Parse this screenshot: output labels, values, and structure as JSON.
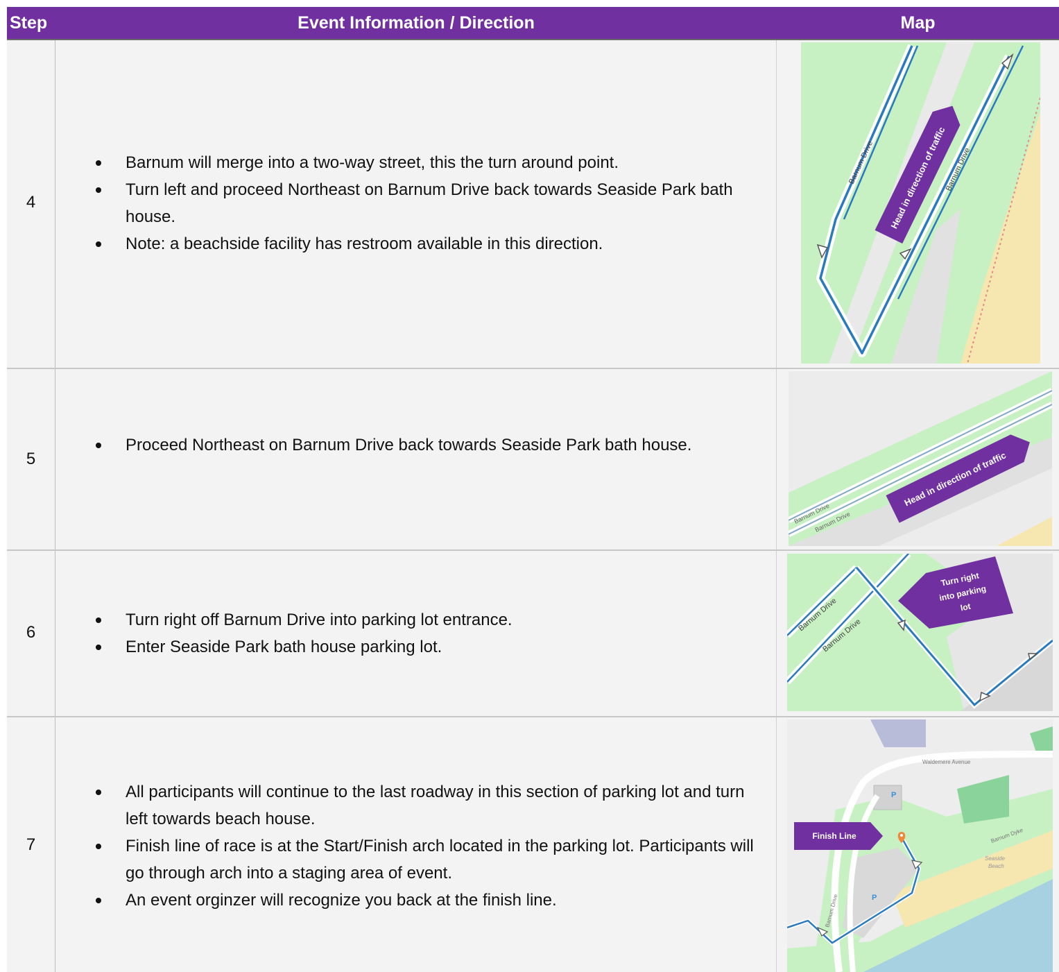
{
  "header": {
    "step": "Step",
    "info": "Event Information / Direction",
    "map": "Map"
  },
  "rows": [
    {
      "step": "4",
      "items": [
        "Barnum will merge into a two-way street, this the turn around point.",
        "Turn left and proceed Northeast on Barnum Drive back towards Seaside Park bath house.",
        "Note: a beachside facility has restroom available in this direction."
      ],
      "map": {
        "callout": "Head in direction of traffic",
        "roads": [
          "Barnum Drive",
          "Barnum Drive"
        ]
      }
    },
    {
      "step": "5",
      "items": [
        "Proceed Northeast on Barnum Drive back towards Seaside Park bath house."
      ],
      "map": {
        "callout": "Head in direction of traffic",
        "roads": [
          "Barnum Drive",
          "Barnum Drive"
        ]
      }
    },
    {
      "step": "6",
      "items": [
        "Turn right off Barnum Drive into parking lot entrance.",
        "Enter Seaside Park bath house parking lot."
      ],
      "map": {
        "callout": "Turn right into parking lot",
        "callout_lines": [
          "Turn right",
          "into parking",
          "lot"
        ],
        "roads": [
          "Barnum Drive",
          "Barnum Drive"
        ]
      }
    },
    {
      "step": "7",
      "items": [
        "All participants will continue to the last roadway in this section of parking lot and turn left towards beach house.",
        "Finish line of race is at the Start/Finish arch located in the parking lot. Participants will go through arch into a staging area of event.",
        "An event orginzer will recognize you back at the finish line."
      ],
      "map": {
        "callout": "Finish Line",
        "roads": [
          "Waldemere Avenue",
          "Barnum Dyke",
          "Barnum Drive"
        ],
        "labels": [
          "Seaside",
          "Beach"
        ],
        "parking": "P"
      }
    }
  ],
  "colors": {
    "header_bg": "#7030a0",
    "callout": "#7030a0",
    "route": "#2a7ac0",
    "grass": "#c7f0c3",
    "sand": "#f6e6b0",
    "water": "#a7d1e0"
  }
}
